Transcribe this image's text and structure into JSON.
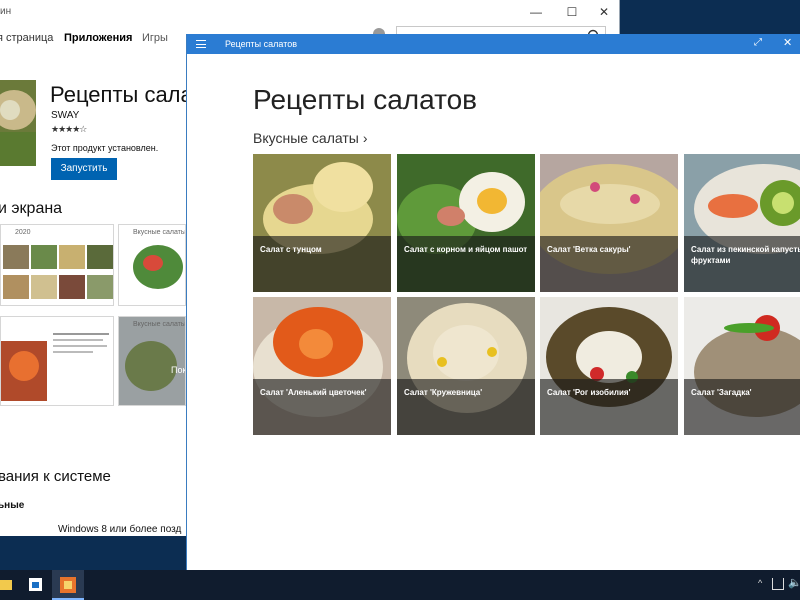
{
  "store": {
    "title": "ин",
    "window_controls": {
      "minimize": "—",
      "maximize": "☐",
      "close": "✕"
    },
    "nav": {
      "home": "я страница",
      "apps": "Приложения",
      "games": "Игры"
    },
    "app": {
      "name": "Рецепты салат",
      "publisher": "SWAY",
      "rating": "★★★★☆",
      "status": "Этот продукт установлен.",
      "launch_label": "Запустить"
    },
    "screens_heading": "и экрана",
    "shots": {
      "shot1_caption": "2020",
      "shot2_caption": "Вкусные салаты",
      "shot4_caption": "Вкусные салаты",
      "shot4_overlay": "Пок"
    },
    "requirements_heading": "вания к системе",
    "requirements_column": "ьные",
    "requirements_os": "Windows 8 или более позд"
  },
  "recipes_window": {
    "title": "Рецепты салатов",
    "expand_icon": "⤢",
    "close": "✕",
    "heading": "Рецепты салатов",
    "section": "Вкусные салаты",
    "section_chevron": "›",
    "tiles": [
      {
        "label": "Салат с тунцом"
      },
      {
        "label": "Салат с корном и яйцом пашот"
      },
      {
        "label": "Салат 'Ветка сакуры'"
      },
      {
        "label": "Салат из пекинской капусты с фруктами"
      },
      {
        "label": "Салат 'Аленький цветочек'"
      },
      {
        "label": "Салат 'Кружевница'"
      },
      {
        "label": "Салат 'Рог изобилия'"
      },
      {
        "label": "Салат 'Загадка'"
      }
    ]
  },
  "taskbar": {
    "tray_arrow": "^",
    "volume_icon": "🔈"
  },
  "colors": {
    "accent": "#2b7cd3",
    "launch_button": "#0063b1",
    "taskbar": "#101c2e"
  }
}
